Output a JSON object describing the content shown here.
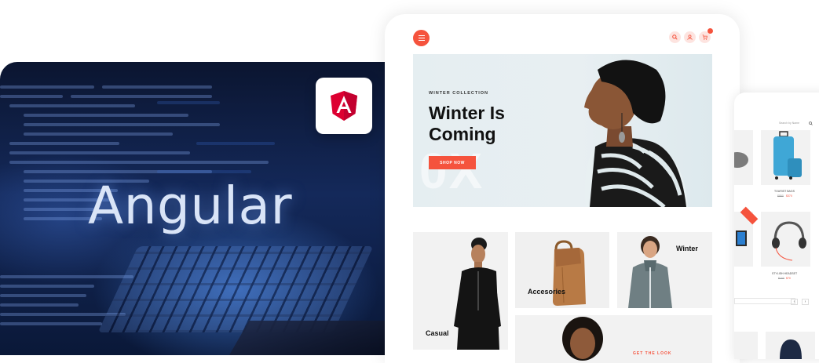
{
  "promo": {
    "title": "Angular",
    "badge_icon": "angular-logo-icon",
    "badge_letter": "A",
    "accent": "#dd0031"
  },
  "shop": {
    "header_icons": [
      "menu-icon",
      "search-icon",
      "user-icon",
      "cart-icon"
    ],
    "accent": "#f5533d",
    "hero": {
      "eyebrow": "WINTER COLLECTION",
      "title": "Winter Is Coming",
      "button": "SHOP NOW",
      "watermark": "0X"
    },
    "tiles": {
      "casual": "Casual",
      "accessories": "Accesories",
      "winter": "Winter",
      "get_the_look": "GET THE LOOK"
    }
  },
  "shop2": {
    "search_placeholder": "Search by Name",
    "product_1": "TOURIST BAGS",
    "product_1_old_price": "$850",
    "product_1_price": "$370",
    "product_2": "STYLISH HEADSET",
    "product_2_old_price": "$100",
    "product_2_price": "$70",
    "pager_prev": "‹",
    "pager_next": "›"
  }
}
